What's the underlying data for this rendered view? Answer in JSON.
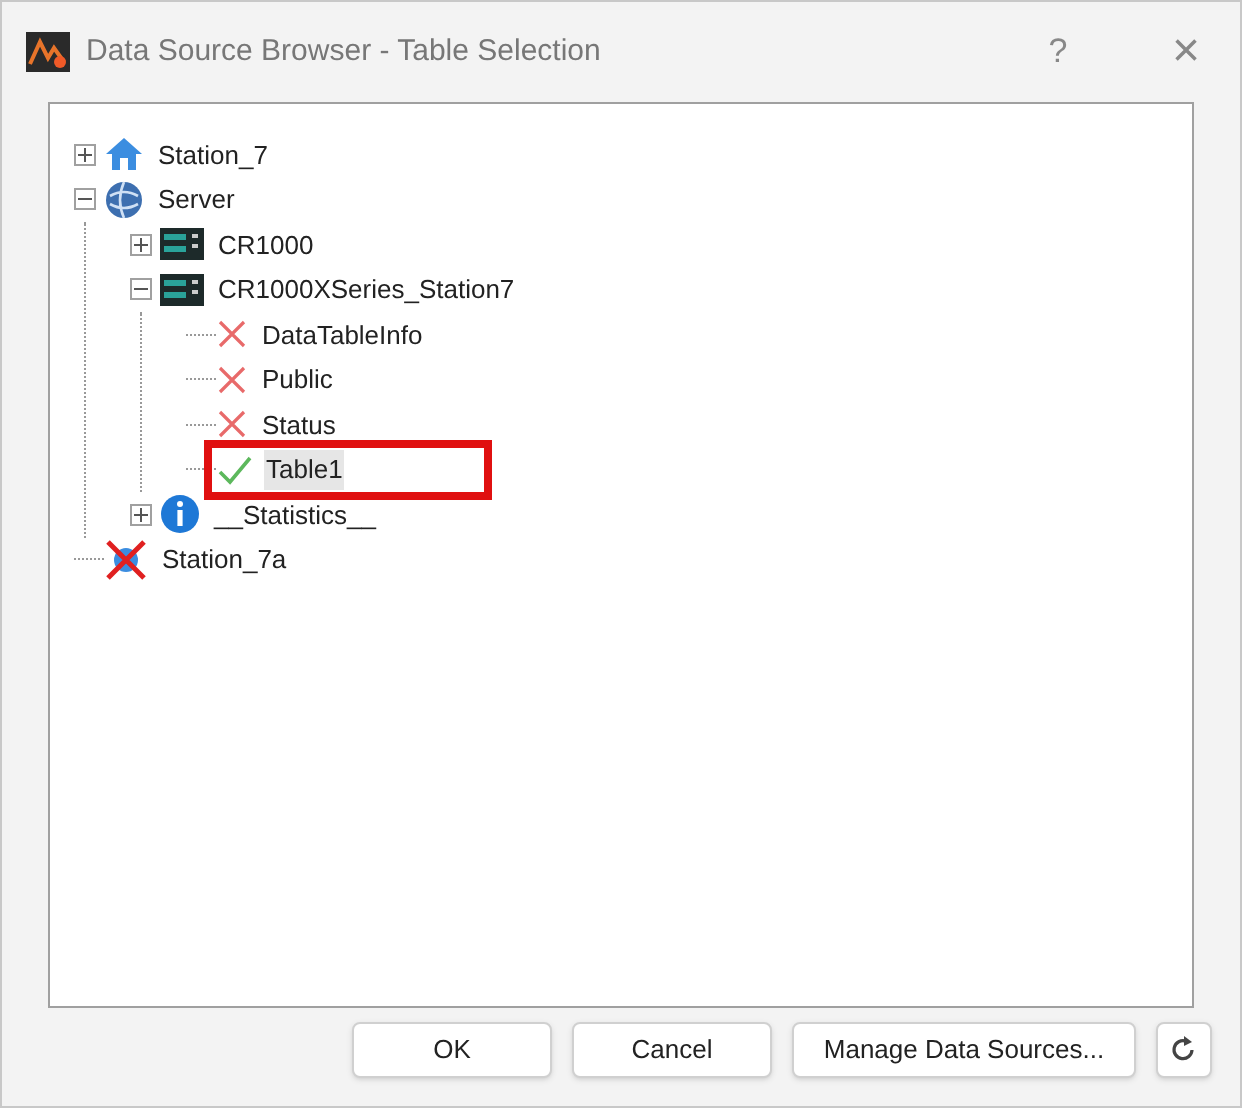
{
  "window": {
    "title": "Data Source Browser - Table Selection",
    "help": "?",
    "close": "×"
  },
  "tree": [
    {
      "label": "Station_7",
      "kind": "home",
      "expanded": false
    },
    {
      "label": "Server",
      "kind": "globe",
      "expanded": true,
      "children": [
        {
          "label": "CR1000",
          "kind": "logger",
          "expanded": false
        },
        {
          "label": "CR1000XSeries_Station7",
          "kind": "logger",
          "expanded": true,
          "children": [
            {
              "label": "DataTableInfo",
              "kind": "cross",
              "selected": false,
              "highlighted": false
            },
            {
              "label": "Public",
              "kind": "cross",
              "selected": false,
              "highlighted": false
            },
            {
              "label": "Status",
              "kind": "cross",
              "selected": false,
              "highlighted": false
            },
            {
              "label": "Table1",
              "kind": "check",
              "selected": true,
              "highlighted": true
            }
          ]
        },
        {
          "label": "__Statistics__",
          "kind": "info",
          "expanded": false
        }
      ]
    },
    {
      "label": "Station_7a",
      "kind": "station-x"
    }
  ],
  "buttons": [
    "OK",
    "Cancel",
    "Manage Data Sources..."
  ]
}
